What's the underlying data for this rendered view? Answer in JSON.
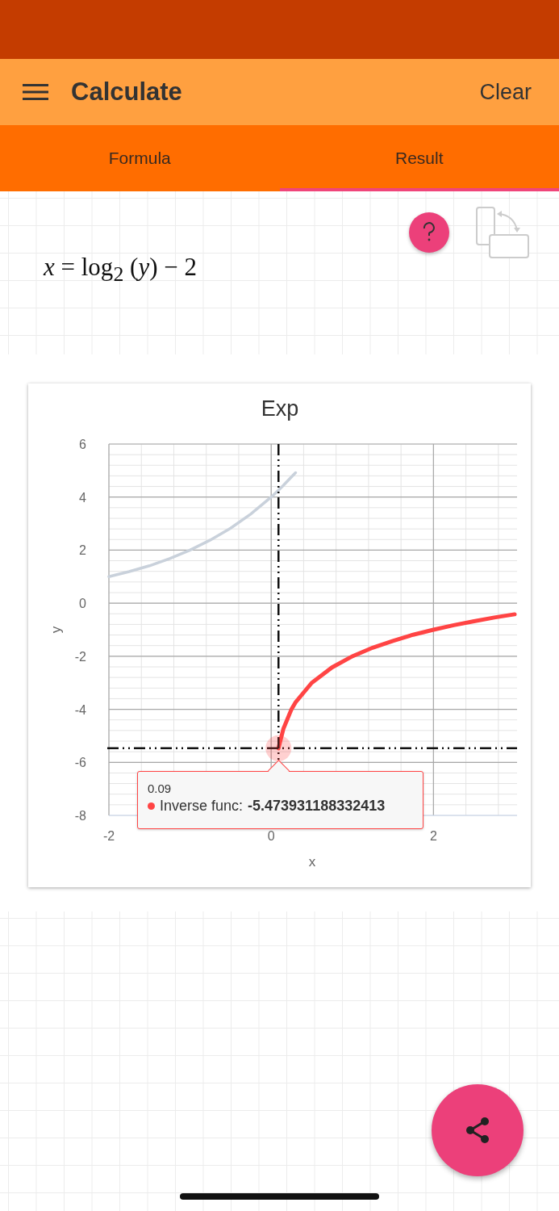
{
  "app_bar": {
    "title": "Calculate",
    "action": "Clear"
  },
  "tabs": [
    {
      "label": "Formula",
      "selected": false
    },
    {
      "label": "Result",
      "selected": true
    }
  ],
  "formula": "*x* = log$_{2}$ (*y*) − 2",
  "chart_data": {
    "type": "line",
    "title": "Exp",
    "xlabel": "x",
    "ylabel": "y",
    "x": [
      -2,
      -1.75,
      -1.5,
      -1.25,
      -1,
      -0.75,
      -0.5,
      -0.25,
      0,
      0.05,
      0.09,
      0.15,
      0.25,
      0.3,
      0.5,
      0.75,
      1,
      1.25,
      1.5,
      1.75,
      2,
      2.25,
      2.5,
      2.75,
      3
    ],
    "series": [
      {
        "color": "#c9d1db",
        "values": [
          1,
          1.19,
          1.41,
          1.68,
          2,
          2.38,
          2.83,
          3.36,
          4,
          4.14,
          4.26,
          4.44,
          4.76,
          4.92,
          null,
          null,
          null,
          null,
          null,
          null,
          null,
          null,
          null,
          null,
          null
        ]
      },
      {
        "color": "#ff4444",
        "values": [
          null,
          null,
          null,
          null,
          null,
          null,
          null,
          null,
          null,
          null,
          -5.47,
          -4.74,
          -4,
          -3.74,
          -3,
          -2.42,
          -2,
          -1.68,
          -1.42,
          -1.19,
          -1,
          -0.83,
          -0.68,
          -0.54,
          -0.42
        ]
      }
    ],
    "xlim": [
      -2,
      3.03
    ],
    "ylim": [
      -8,
      6
    ],
    "xticks": [
      -2,
      0,
      2
    ],
    "yticks": [
      -8,
      -6,
      -4,
      -2,
      0,
      2,
      4,
      6
    ],
    "grid": true,
    "ref_lines": [
      {
        "axis": "x",
        "value": 0.09
      },
      {
        "axis": "y",
        "value": -5.47
      }
    ]
  },
  "tooltip": {
    "x_value": "0.09",
    "label": "Inverse func:",
    "value": "-5.473931188332413",
    "color": "#ff4444"
  }
}
